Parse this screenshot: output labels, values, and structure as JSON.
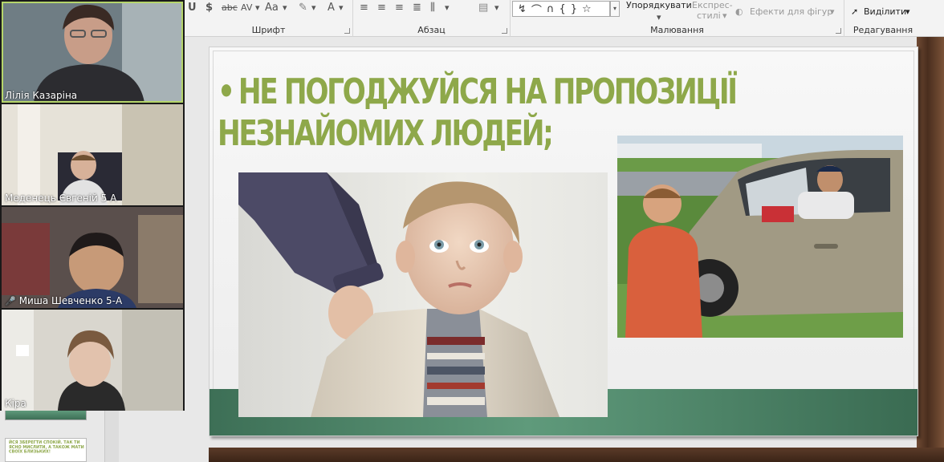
{
  "ribbon": {
    "groups": {
      "font": "Шрифт",
      "paragraph": "Абзац",
      "drawing": "Малювання",
      "editing": "Редагування"
    },
    "tools": {
      "strikethrough": "abc",
      "char_spacing": "AV",
      "font_size": "Aa",
      "font_color": "A",
      "arrange": "Упорядкувати",
      "quick_styles_line1": "Експрес-",
      "quick_styles_line2": "стилі",
      "shape_effects": "Ефекти для фігур",
      "select": "Виділити",
      "dollar": "$"
    }
  },
  "slide": {
    "title_line1": "НЕ ПОГОДЖУЙСЯ НА ПРОПОЗИЦІЇ",
    "title_line2": "НЕЗНАЙОМИХ ЛЮДЕЙ;",
    "bullet": "•"
  },
  "participants": [
    {
      "name": "Лілія Казаріна",
      "muted": false
    },
    {
      "name": "Меденець Євгеній 5 А",
      "muted": false
    },
    {
      "name": "Миша Шевченко 5-А",
      "muted": true
    },
    {
      "name": "Кіра",
      "muted": false
    }
  ],
  "thumbnail": {
    "text": "ЙСЯ ЗБЕРЕГТИ СПОКІЙ. ТАК ТИ ЯСНО МИСЛИТИ, А ТАКОЖ МАТИ СВОЇХ БЛИЗЬКИХ!"
  },
  "colors": {
    "title_green": "#8ea84a",
    "band_green": "#5f9a7b",
    "active_speaker": "#b5d56a"
  }
}
